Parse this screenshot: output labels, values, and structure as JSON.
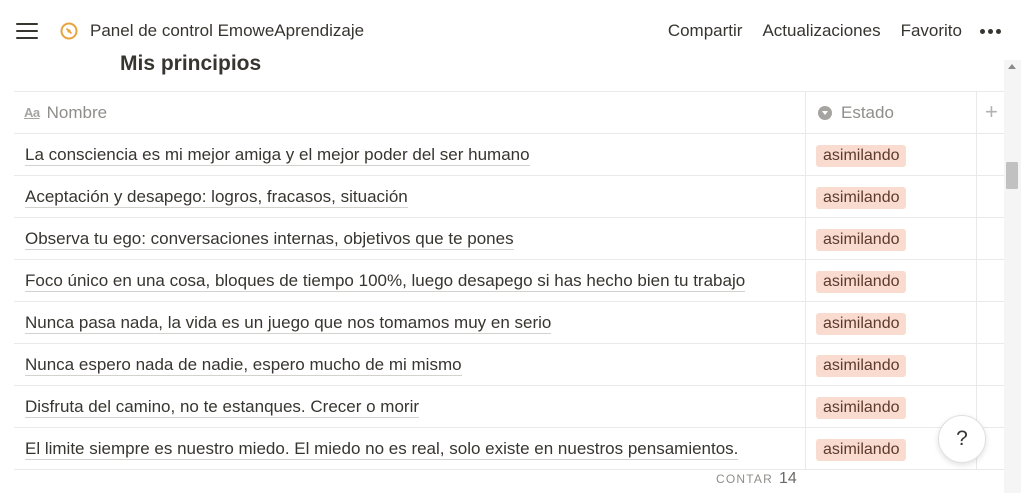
{
  "topbar": {
    "breadcrumb": "Panel de control EmoweAprendizaje",
    "page_icon": "compass-icon",
    "actions": {
      "share": "Compartir",
      "updates": "Actualizaciones",
      "favorite": "Favorito"
    }
  },
  "database": {
    "title": "Mis principios",
    "columns": {
      "name_icon": "Aa",
      "name": "Nombre",
      "status": "Estado"
    },
    "rows": [
      {
        "name": "La consciencia es mi mejor amiga y el mejor poder del ser humano",
        "status": "asimilando"
      },
      {
        "name": "Aceptación y desapego: logros, fracasos, situación",
        "status": "asimilando"
      },
      {
        "name": "Observa tu ego: conversaciones internas, objetivos que te pones",
        "status": "asimilando"
      },
      {
        "name": "Foco único en una cosa, bloques de tiempo 100%, luego desapego si has hecho bien tu trabajo",
        "status": "asimilando"
      },
      {
        "name": "Nunca pasa nada, la vida es un juego que nos tomamos muy en serio",
        "status": "asimilando"
      },
      {
        "name": "Nunca espero nada de nadie, espero mucho de mi mismo",
        "status": "asimilando"
      },
      {
        "name": "Disfruta del camino, no te estanques. Crecer o morir",
        "status": "asimilando"
      },
      {
        "name": "El limite siempre es nuestro miedo. El miedo no es real, solo existe en nuestros pensamientos.",
        "status": "asimilando"
      }
    ],
    "footer": {
      "count_label": "CONTAR",
      "count_value": "14"
    }
  },
  "help": {
    "label": "?"
  },
  "colors": {
    "badge_bg": "#fadbd0",
    "text": "#37352f",
    "icon_accent": "#e8a33d"
  }
}
